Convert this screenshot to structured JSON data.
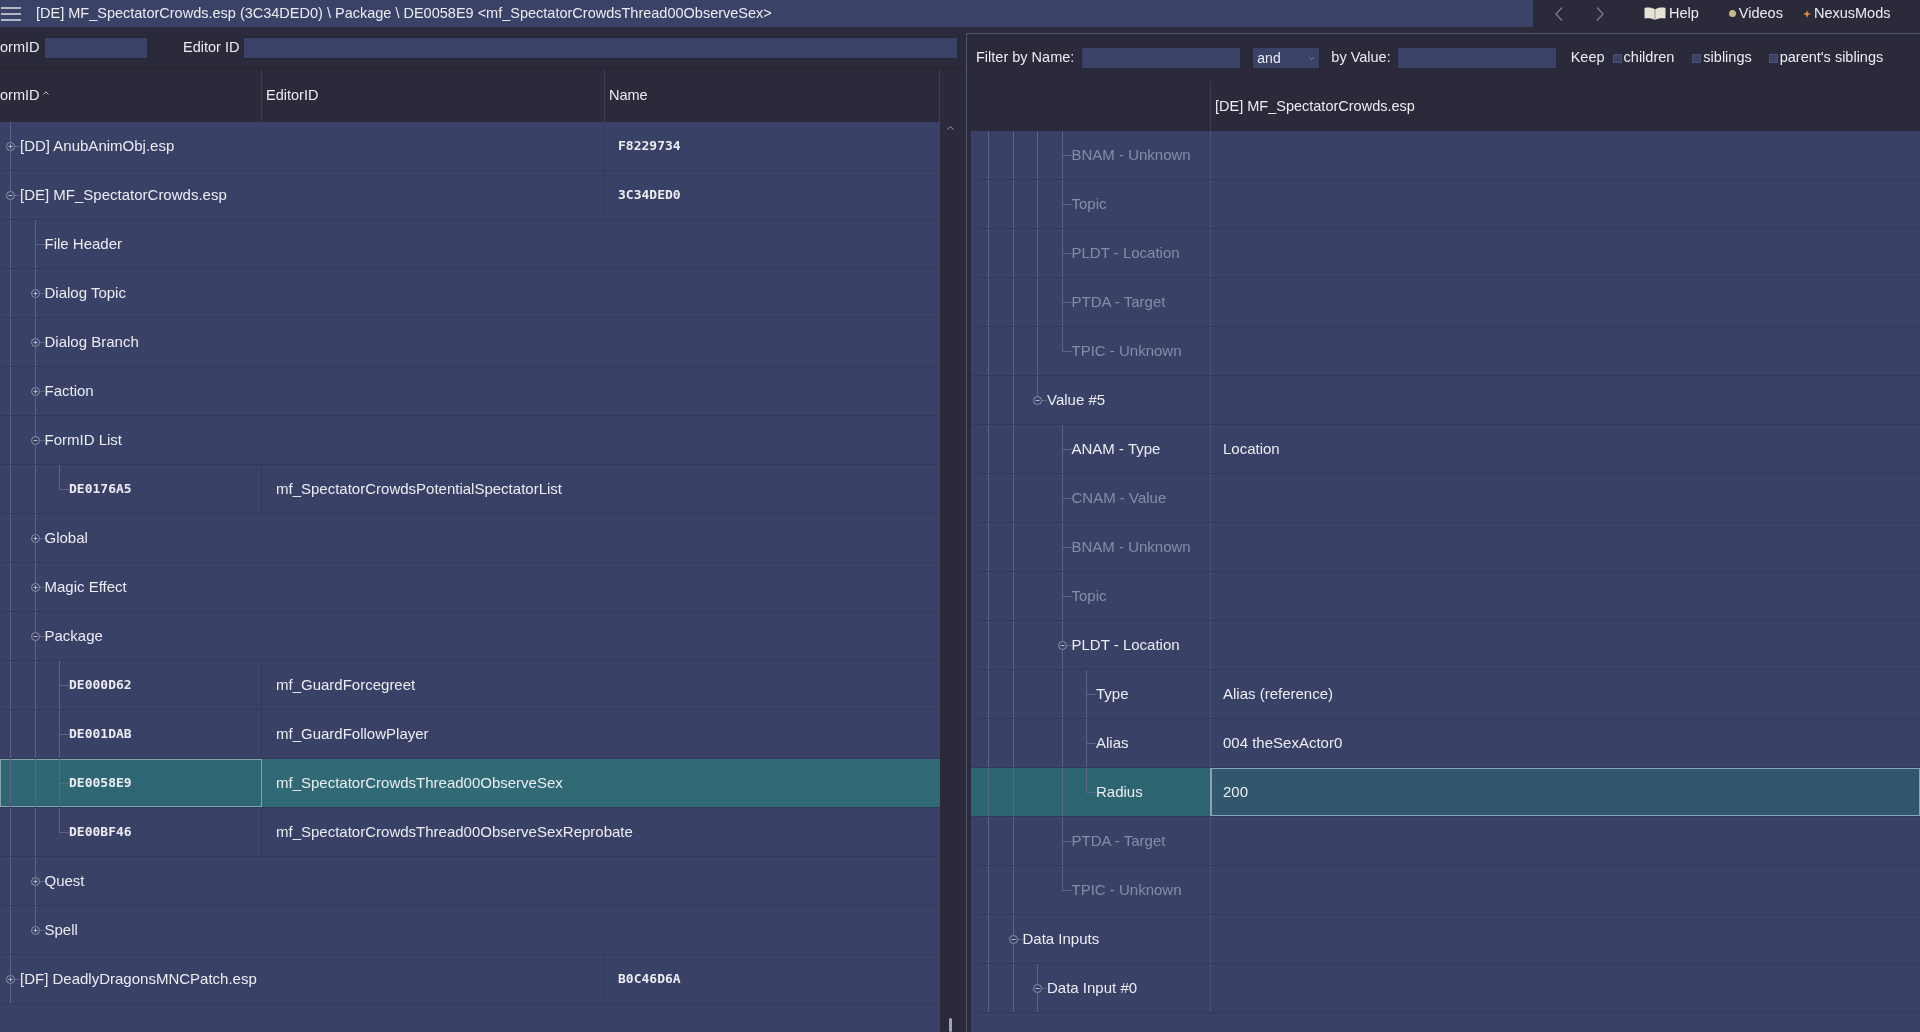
{
  "window": {
    "title": "[DE] MF_SpectatorCrowds.esp (3C34DED0) \\ Package \\ DE0058E9 <mf_SpectatorCrowdsThread00ObserveSex>"
  },
  "toolbar_links": [
    {
      "kind": "help",
      "label": "Help"
    },
    {
      "kind": "videos",
      "label": "Videos"
    },
    {
      "kind": "nexus",
      "label": "NexusMods"
    }
  ],
  "record_search": {
    "form_id_label": "ormID",
    "editor_id_label": "Editor ID"
  },
  "record_tree": {
    "columns": [
      {
        "label": "ormID",
        "sorted": true
      },
      {
        "label": "EditorID",
        "sorted": false
      },
      {
        "label": "Name",
        "sorted": false
      }
    ],
    "rows": [
      {
        "kind": "plugin",
        "label": "[DD] AnubAnimObj.esp",
        "name": "F8229734",
        "expanded": false,
        "selected": false
      },
      {
        "kind": "plugin",
        "label": "[DE] MF_SpectatorCrowds.esp",
        "name": "3C34DED0",
        "expanded": true,
        "selected": false,
        "children": [
          {
            "kind": "header",
            "label": "File Header",
            "selected": false
          },
          {
            "kind": "group",
            "label": "Dialog Topic",
            "expanded": false,
            "selected": false
          },
          {
            "kind": "group",
            "label": "Dialog Branch",
            "expanded": false,
            "selected": false
          },
          {
            "kind": "group",
            "label": "Faction",
            "expanded": false,
            "selected": false
          },
          {
            "kind": "group",
            "label": "FormID List",
            "expanded": true,
            "selected": false,
            "children": [
              {
                "kind": "record",
                "form_id": "DE0176A5",
                "editor_id": "mf_SpectatorCrowdsPotentialSpectatorList",
                "selected": false
              }
            ]
          },
          {
            "kind": "group",
            "label": "Global",
            "expanded": false,
            "selected": false
          },
          {
            "kind": "group",
            "label": "Magic Effect",
            "expanded": false,
            "selected": false
          },
          {
            "kind": "group",
            "label": "Package",
            "expanded": true,
            "selected": false,
            "children": [
              {
                "kind": "record",
                "form_id": "DE000D62",
                "editor_id": "mf_GuardForcegreet",
                "selected": false
              },
              {
                "kind": "record",
                "form_id": "DE001DAB",
                "editor_id": "mf_GuardFollowPlayer",
                "selected": false
              },
              {
                "kind": "record",
                "form_id": "DE0058E9",
                "editor_id": "mf_SpectatorCrowdsThread00ObserveSex",
                "selected": true
              },
              {
                "kind": "record",
                "form_id": "DE00BF46",
                "editor_id": "mf_SpectatorCrowdsThread00ObserveSexReprobate",
                "selected": false
              }
            ]
          },
          {
            "kind": "group",
            "label": "Quest",
            "expanded": false,
            "selected": false
          },
          {
            "kind": "group",
            "label": "Spell",
            "expanded": false,
            "selected": false
          }
        ]
      },
      {
        "kind": "plugin",
        "label": "[DF] DeadlyDragonsMNCPatch.esp",
        "name": "B0C46D6A",
        "expanded": false,
        "selected": false
      }
    ]
  },
  "record_filter": {
    "name_label": "Filter by Name:",
    "operator": "and",
    "value_label": "by Value:",
    "keep_label": "Keep",
    "keep_options": [
      {
        "label": "children",
        "checked": false
      },
      {
        "label": "siblings",
        "checked": false
      },
      {
        "label": "parent's siblings",
        "checked": false
      }
    ]
  },
  "record_view": {
    "header": "[DE] MF_SpectatorCrowds.esp",
    "rows": [
      {
        "kind": "offscreen",
        "children": [
          {
            "kind": "offscreen",
            "children": [
              {
                "kind": "offscreen",
                "children": [
                  {
                    "kind": "field",
                    "label": "BNAM - Unknown",
                    "disabled": true,
                    "selected": false
                  },
                  {
                    "kind": "field",
                    "label": "Topic",
                    "disabled": true,
                    "selected": false
                  },
                  {
                    "kind": "field",
                    "label": "PLDT - Location",
                    "disabled": true,
                    "selected": false
                  },
                  {
                    "kind": "field",
                    "label": "PTDA - Target",
                    "disabled": true,
                    "selected": false
                  },
                  {
                    "kind": "field",
                    "label": "TPIC - Unknown",
                    "disabled": true,
                    "selected": false
                  }
                ]
              },
              {
                "kind": "branch",
                "label": "Value #5",
                "expanded": true,
                "disabled": false,
                "selected": false,
                "children": [
                  {
                    "kind": "field",
                    "label": "ANAM - Type",
                    "value": "Location",
                    "disabled": false,
                    "selected": false
                  },
                  {
                    "kind": "field",
                    "label": "CNAM - Value",
                    "disabled": true,
                    "selected": false
                  },
                  {
                    "kind": "field",
                    "label": "BNAM - Unknown",
                    "disabled": true,
                    "selected": false
                  },
                  {
                    "kind": "field",
                    "label": "Topic",
                    "disabled": true,
                    "selected": false
                  },
                  {
                    "kind": "branch",
                    "label": "PLDT - Location",
                    "expanded": true,
                    "disabled": false,
                    "selected": false,
                    "children": [
                      {
                        "kind": "field",
                        "label": "Type",
                        "value": "Alias (reference)",
                        "disabled": false,
                        "selected": false
                      },
                      {
                        "kind": "field",
                        "label": "Alias",
                        "value": "004 theSexActor0",
                        "disabled": false,
                        "selected": false
                      },
                      {
                        "kind": "field",
                        "label": "Radius",
                        "value": "200",
                        "disabled": false,
                        "selected": true
                      }
                    ]
                  },
                  {
                    "kind": "field",
                    "label": "PTDA - Target",
                    "disabled": true,
                    "selected": false
                  },
                  {
                    "kind": "field",
                    "label": "TPIC - Unknown",
                    "disabled": true,
                    "selected": false
                  }
                ]
              }
            ]
          },
          {
            "kind": "branch",
            "label": "Data Inputs",
            "expanded": true,
            "disabled": false,
            "selected": false,
            "children": [
              {
                "kind": "branch",
                "label": "Data Input #0",
                "expanded": true,
                "disabled": false,
                "selected": false
              }
            ]
          }
        ]
      }
    ]
  }
}
